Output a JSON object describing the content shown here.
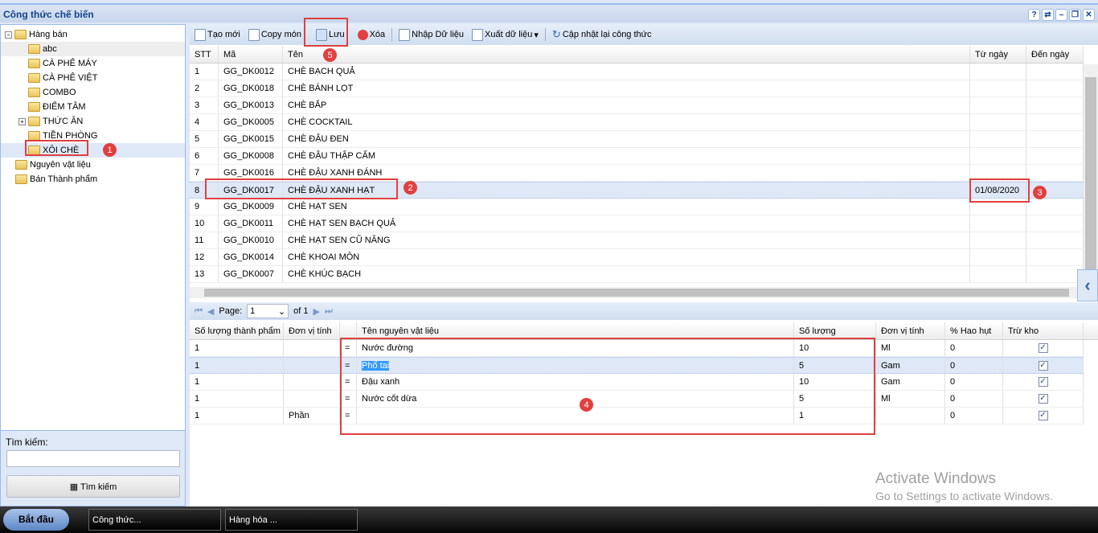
{
  "window": {
    "title": "Công thức chế biến",
    "buttons": [
      "?",
      "⇄",
      "–",
      "❐",
      "✕"
    ]
  },
  "tree": {
    "items": [
      {
        "label": "Hàng bán",
        "level": 0,
        "expander": "−"
      },
      {
        "label": "abc",
        "level": 1
      },
      {
        "label": "CÀ PHÊ MÁY",
        "level": 1
      },
      {
        "label": "CÀ PHÊ VIỆT",
        "level": 1
      },
      {
        "label": "COMBO",
        "level": 1
      },
      {
        "label": "ĐIỂM TÂM",
        "level": 1
      },
      {
        "label": "THỨC ĂN",
        "level": 1,
        "expander": "+"
      },
      {
        "label": "TIỀN PHÒNG",
        "level": 1
      },
      {
        "label": "XÔI CHÈ",
        "level": 1,
        "selected": true
      },
      {
        "label": "Nguyên vật liệu",
        "level": 0
      },
      {
        "label": "Bán Thành phẩm",
        "level": 0
      }
    ]
  },
  "search": {
    "label": "Tìm kiếm:",
    "value": "",
    "button": "Tìm kiếm"
  },
  "toolbar": {
    "new": "Tạo mới",
    "copy": "Copy món",
    "save": "Lưu",
    "delete": "Xóa",
    "import": "Nhập Dữ liệu",
    "export": "Xuất dữ liệu",
    "update": "Cập nhật lại công thức"
  },
  "grid": {
    "headers": [
      "STT",
      "Mã",
      "Tên",
      "Từ ngày",
      "Đến ngày"
    ],
    "rows": [
      [
        "1",
        "GG_DK0012",
        "CHÈ BẠCH QUẢ",
        "",
        ""
      ],
      [
        "2",
        "GG_DK0018",
        "CHÈ BÁNH LỌT",
        "",
        ""
      ],
      [
        "3",
        "GG_DK0013",
        "CHÈ BẮP",
        "",
        ""
      ],
      [
        "4",
        "GG_DK0005",
        "CHÈ COCKTAIL",
        "",
        ""
      ],
      [
        "5",
        "GG_DK0015",
        "CHÈ ĐẬU ĐEN",
        "",
        ""
      ],
      [
        "6",
        "GG_DK0008",
        "CHÈ ĐẬU THẬP CẨM",
        "",
        ""
      ],
      [
        "7",
        "GG_DK0016",
        "CHÈ ĐẬU XANH ĐÁNH",
        "",
        ""
      ],
      [
        "8",
        "GG_DK0017",
        "CHÈ ĐẬU XANH HẠT",
        "01/08/2020",
        ""
      ],
      [
        "9",
        "GG_DK0009",
        "CHÈ HẠT SEN",
        "",
        ""
      ],
      [
        "10",
        "GG_DK0011",
        "CHÈ HẠT SEN BẠCH QUẢ",
        "",
        ""
      ],
      [
        "11",
        "GG_DK0010",
        "CHÈ HẠT SEN CŨ NĂNG",
        "",
        ""
      ],
      [
        "12",
        "GG_DK0014",
        "CHÈ KHOAI MÔN",
        "",
        ""
      ],
      [
        "13",
        "GG_DK0007",
        "CHÈ KHÚC BẠCH",
        "",
        ""
      ]
    ]
  },
  "pager": {
    "label": "Page:",
    "page": "1",
    "of": "of 1"
  },
  "detail": {
    "headers": [
      "Số lượng thành phẩm",
      "Đơn vị tính",
      "",
      "Tên nguyên vật liệu",
      "Số lượng",
      "Đơn vị tính",
      "% Hao hụt",
      "Trừ kho"
    ],
    "rows": [
      [
        "1",
        "",
        "=",
        "Nước đường",
        "10",
        "Ml",
        "0",
        true
      ],
      [
        "1",
        "",
        "=",
        "Phổ tai",
        "5",
        "Gam",
        "0",
        true
      ],
      [
        "1",
        "",
        "=",
        "Đậu xanh",
        "10",
        "Gam",
        "0",
        true
      ],
      [
        "1",
        "",
        "=",
        "Nước cốt dừa",
        "5",
        "Ml",
        "0",
        true
      ],
      [
        "1",
        "Phần",
        "=",
        "",
        "1",
        "",
        "0",
        true
      ]
    ]
  },
  "annotations": [
    "1",
    "2",
    "3",
    "4",
    "5"
  ],
  "taskbar": {
    "start": "Bắt đầu",
    "tasks": [
      "Công thức...",
      "Hàng hóa ..."
    ]
  },
  "watermark": {
    "title": "Activate Windows",
    "subtitle": "Go to Settings to activate Windows."
  }
}
